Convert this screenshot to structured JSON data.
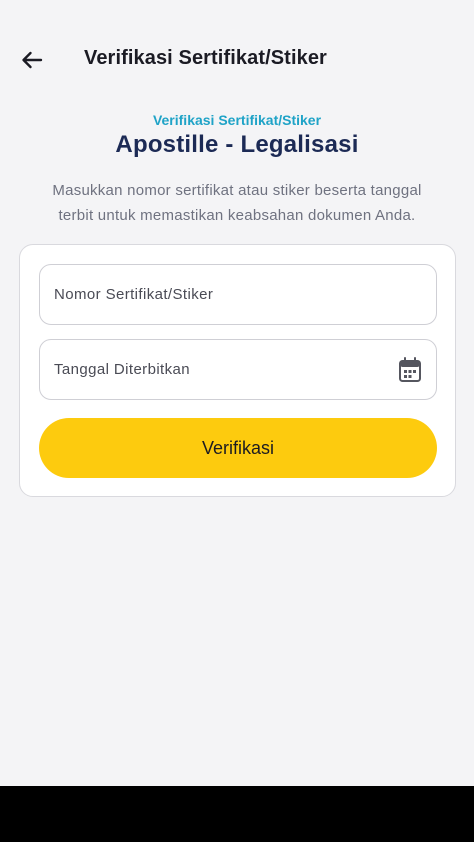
{
  "appbar": {
    "title": "Verifikasi Sertifikat/Stiker",
    "back_icon": "arrow-left-icon"
  },
  "hero": {
    "eyebrow": "Verifikasi Sertifikat/Stiker",
    "title": "Apostille - Legalisasi",
    "description_line1": "Masukkan nomor sertifikat atau stiker beserta tanggal",
    "description_line2": "terbit untuk memastikan keabsahan dokumen Anda."
  },
  "form": {
    "certificate_placeholder": "Nomor Sertifikat/Stiker",
    "date_placeholder": "Tanggal Diterbitkan",
    "date_icon": "calendar-icon",
    "submit_label": "Verifikasi"
  },
  "colors": {
    "background": "#f4f4f6",
    "accent_eyebrow": "#1fa3c7",
    "title": "#1c2a55",
    "button": "#fdcb0e"
  }
}
